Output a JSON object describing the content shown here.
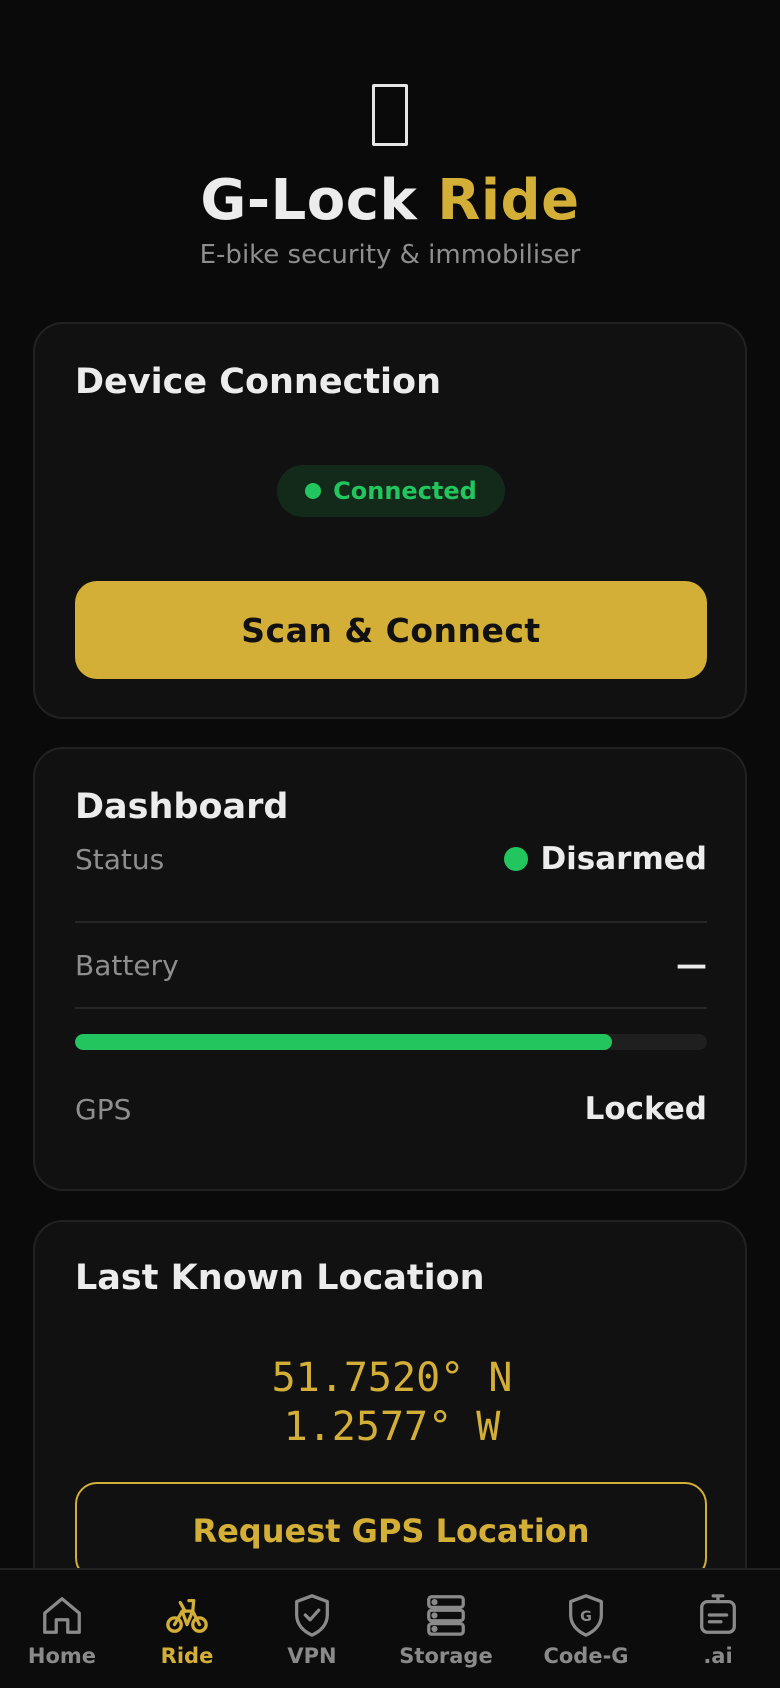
{
  "header": {
    "title_main": "G-Lock",
    "title_accent": "Ride",
    "subtitle": "E-bike security & immobiliser"
  },
  "connection": {
    "title": "Device Connection",
    "status": "Connected",
    "button_label": "Scan & Connect"
  },
  "dashboard": {
    "title": "Dashboard",
    "status_label": "Status",
    "status_value": "Disarmed",
    "battery_label": "Battery",
    "battery_value": "—",
    "battery_level_percent": 85,
    "gps_label": "GPS",
    "gps_value": "Locked"
  },
  "location": {
    "title": "Last Known Location",
    "latitude": "51.7520° N",
    "longitude": "1.2577° W",
    "button_label": "Request GPS Location"
  },
  "nav": {
    "items": [
      {
        "label": "Home",
        "icon": "home-icon",
        "active": false
      },
      {
        "label": "Ride",
        "icon": "bike-icon",
        "active": true
      },
      {
        "label": "VPN",
        "icon": "shield-check-icon",
        "active": false
      },
      {
        "label": "Storage",
        "icon": "storage-icon",
        "active": false
      },
      {
        "label": "Code-G",
        "icon": "shield-g-icon",
        "active": false
      },
      {
        "label": ".ai",
        "icon": "ai-bot-icon",
        "active": false
      }
    ]
  },
  "colors": {
    "accent": "#d4af37",
    "success": "#22c55e",
    "background": "#0a0a0a",
    "card": "#111111"
  }
}
